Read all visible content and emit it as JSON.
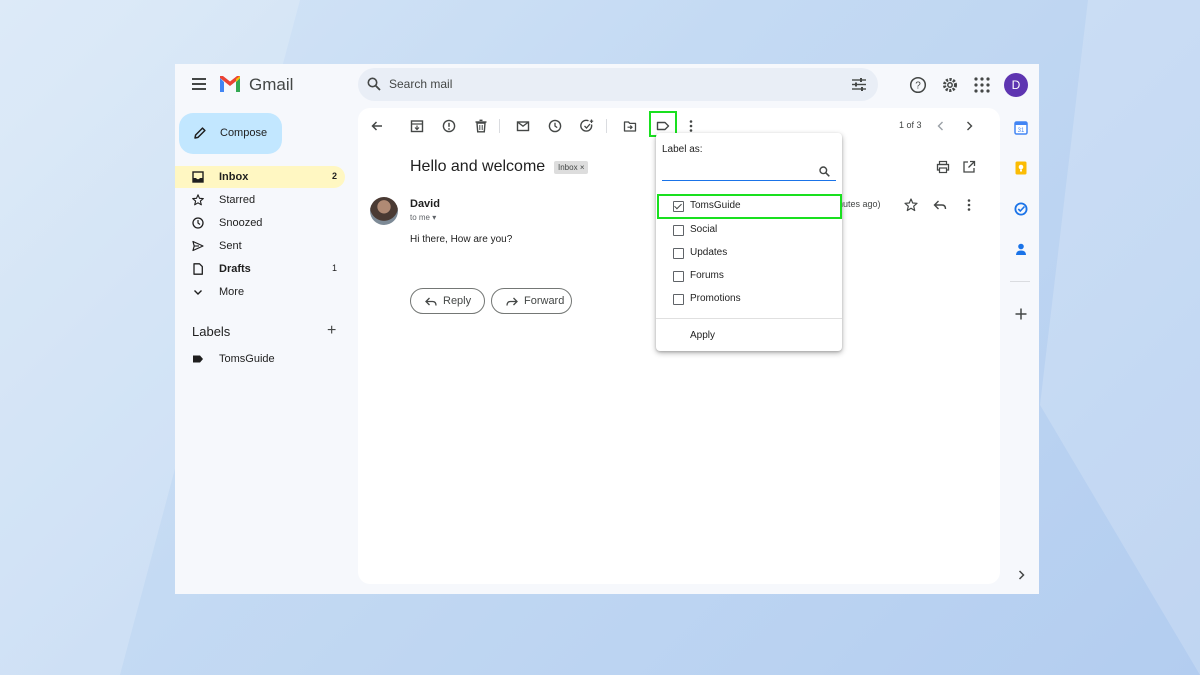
{
  "app": {
    "name": "Gmail"
  },
  "search": {
    "placeholder": "Search mail"
  },
  "account": {
    "initial": "D"
  },
  "compose": {
    "label": "Compose"
  },
  "nav": [
    {
      "label": "Inbox",
      "count": "2",
      "active": true,
      "icon": "inbox-icon"
    },
    {
      "label": "Starred",
      "count": "",
      "icon": "star-icon"
    },
    {
      "label": "Snoozed",
      "count": "",
      "icon": "clock-icon"
    },
    {
      "label": "Sent",
      "count": "",
      "icon": "send-icon"
    },
    {
      "label": "Drafts",
      "count": "1",
      "icon": "draft-icon"
    },
    {
      "label": "More",
      "count": "",
      "icon": "chevron-down-icon"
    }
  ],
  "labels": {
    "title": "Labels",
    "items": [
      {
        "label": "TomsGuide"
      }
    ]
  },
  "toolbar": {
    "pager": "1 of 3"
  },
  "email": {
    "subject": "Hello and welcome",
    "chip": "Inbox",
    "sender": "David",
    "to": "to me",
    "time": "inutes ago)",
    "body": "Hi there, How are you?",
    "reply_label": "Reply",
    "forward_label": "Forward"
  },
  "label_menu": {
    "title": "Label as:",
    "items": [
      {
        "label": "TomsGuide",
        "checked": true
      },
      {
        "label": "Social",
        "checked": false
      },
      {
        "label": "Updates",
        "checked": false
      },
      {
        "label": "Forums",
        "checked": false
      },
      {
        "label": "Promotions",
        "checked": false
      }
    ],
    "apply_label": "Apply"
  },
  "colors": {
    "highlight": "#19e01f",
    "compose_bg": "#c2e7ff",
    "active_nav": "#fff7c2",
    "avatar": "#5e35b1"
  }
}
